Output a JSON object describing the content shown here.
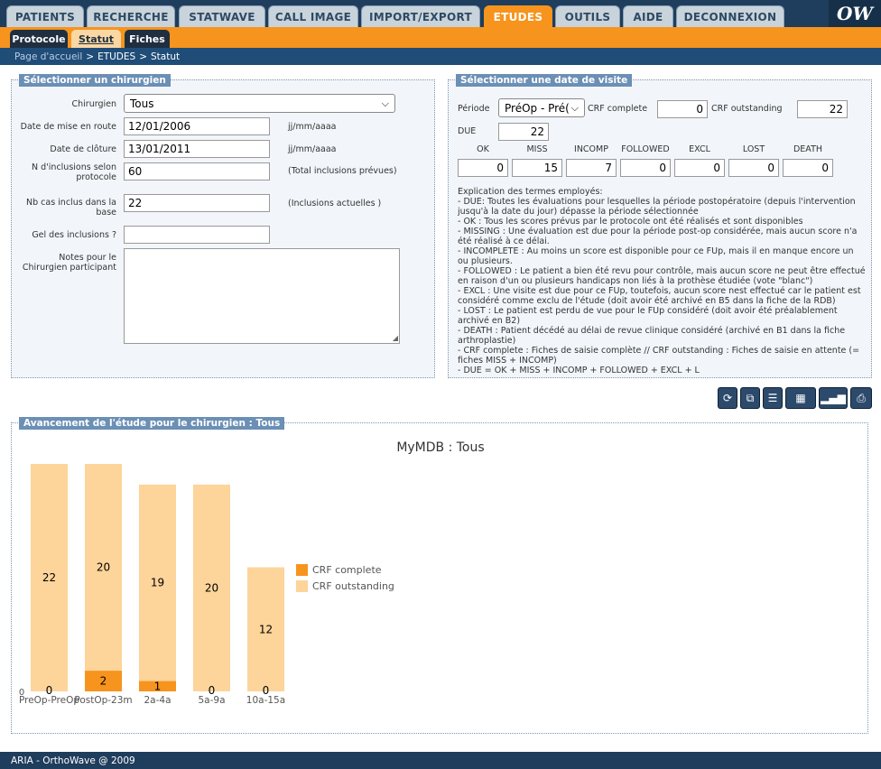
{
  "nav": {
    "tabs": [
      {
        "label": "PATIENTS"
      },
      {
        "label": "RECHERCHE"
      },
      {
        "label": "STATWAVE"
      },
      {
        "label": "CALL IMAGE"
      },
      {
        "label": "IMPORT/EXPORT"
      },
      {
        "label": "ETUDES",
        "active": true
      },
      {
        "label": "OUTILS"
      },
      {
        "label": "AIDE"
      },
      {
        "label": "DECONNEXION"
      }
    ],
    "subtabs": [
      {
        "label": "Protocole"
      },
      {
        "label": "Statut",
        "active": true
      },
      {
        "label": "Fiches"
      }
    ]
  },
  "breadcrumb": {
    "home": "Page d'accueil",
    "sep": ">",
    "section": "ETUDES",
    "page": "Statut"
  },
  "surgeon_panel": {
    "legend": "Sélectionner un chirurgien",
    "chirurgien_label": "Chirurgien",
    "chirurgien_value": "Tous",
    "start_label": "Date de mise en route",
    "start_value": "12/01/2006",
    "end_label": "Date de clôture",
    "end_value": "13/01/2011",
    "date_hint": "jj/mm/aaaa",
    "inclusions_label": "N d'inclusions selon protocole",
    "inclusions_value": "60",
    "inclusions_hint": "(Total inclusions prévues)",
    "cases_label": "Nb cas inclus dans la base",
    "cases_value": "22",
    "cases_hint": "(Inclusions actuelles )",
    "freeze_label": "Gel des inclusions ?",
    "freeze_value": "",
    "notes_label": "Notes pour le Chirurgien participant",
    "notes_value": ""
  },
  "visit_panel": {
    "legend": "Sélectionner une date de visite",
    "periode_label": "Période",
    "periode_value": "PréOp - Pré(",
    "crf_complete_label": "CRF complete",
    "crf_complete_value": "0",
    "crf_outstanding_label": "CRF outstanding",
    "crf_outstanding_value": "22",
    "due_label": "DUE",
    "due_value": "22",
    "status_columns": [
      {
        "label": "OK",
        "value": "0"
      },
      {
        "label": "MISS",
        "value": "15"
      },
      {
        "label": "INCOMP",
        "value": "7"
      },
      {
        "label": "FOLLOWED",
        "value": "0"
      },
      {
        "label": "EXCL",
        "value": "0"
      },
      {
        "label": "LOST",
        "value": "0"
      },
      {
        "label": "DEATH",
        "value": "0"
      }
    ],
    "explanation": [
      "Explication des termes employés:",
      "- DUE: Toutes les évaluations pour lesquelles la période postopératoire (depuis l'intervention jusqu'à la date du jour) dépasse la période sélectionnée",
      "- OK : Tous les scores prévus par le protocole ont été réalisés et sont disponibles",
      "- MISSING : Une évaluation est due pour la période post-op considérée, mais aucun score n'a été réalisé à ce délai.",
      "- INCOMPLETE : Au moins un score est disponible pour ce FUp, mais il en manque encore un ou plusieurs.",
      "- FOLLOWED : Le patient a bien été revu pour contrôle, mais aucun score ne peut être effectué en raison d'un ou plusieurs handicaps non liés à la prothèse étudiée (vote \"blanc\")",
      "- EXCL : Une visite est due pour ce FUp, toutefois, aucun score nest effectué car le patient est considéré comme exclu de l'étude (doit avoir été archivé en B5 dans la fiche de la RDB)",
      "- LOST : Le patient est perdu de vue pour le FUp considéré (doit avoir été préalablement archivé en B2)",
      "- DEATH : Patient décédé au délai de revue clinique considéré (archivé en B1 dans la fiche arthroplastie)",
      "- CRF complete : Fiches de saisie complète // CRF outstanding : Fiches de saisie en attente (= fiches MISS + INCOMP)",
      "- DUE = OK + MISS + INCOMP + FOLLOWED + EXCL + L"
    ]
  },
  "toolbar": {
    "icons": [
      "refresh-icon",
      "copy-icon",
      "clipboard-icon",
      "table-export-icon",
      "chart-export-icon",
      "print-icon"
    ]
  },
  "progress_panel": {
    "legend": "Avancement de l'étude pour le chirurgien : Tous"
  },
  "chart_data": {
    "type": "bar",
    "title": "MyMDB : Tous",
    "categories": [
      "PreOp-PreOp",
      "PostOp-23m",
      "2a-4a",
      "5a-9a",
      "10a-15a"
    ],
    "series": [
      {
        "name": "CRF complete",
        "values": [
          0,
          2,
          1,
          0,
          0
        ],
        "color": "#f7941d"
      },
      {
        "name": "CRF outstanding",
        "values": [
          22,
          20,
          19,
          20,
          12
        ],
        "color": "#fdd49a"
      }
    ],
    "stacked": true,
    "ylim": [
      0,
      22
    ],
    "y_tick_label": "0",
    "legend_position": "right"
  },
  "footer": {
    "text": "ARIA - OrthoWave @ 2009"
  }
}
